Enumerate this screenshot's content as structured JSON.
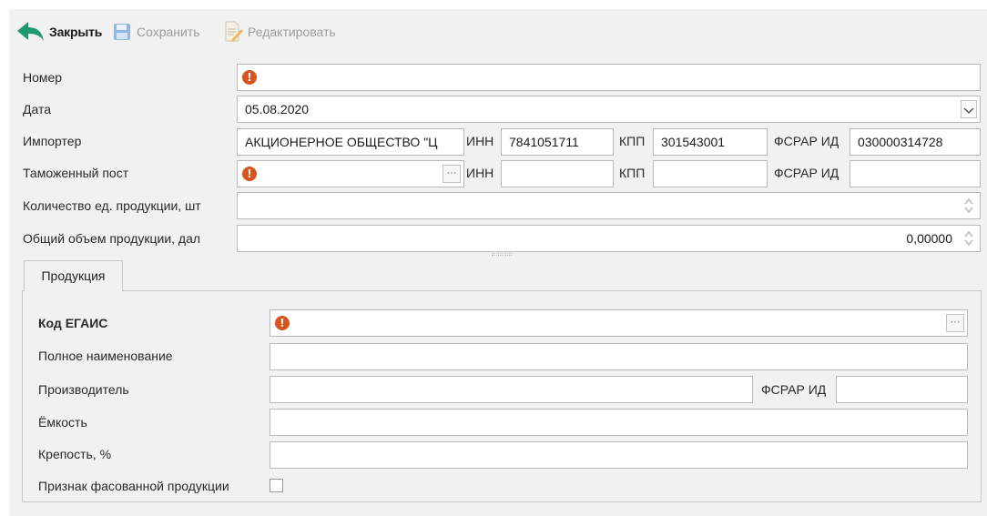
{
  "toolbar": {
    "close_label": "Закрыть",
    "save_label": "Сохранить",
    "edit_label": "Редактировать",
    "close_icon_color": "#1f9a6e",
    "save_icon_color": "#6fa3d8"
  },
  "form": {
    "number": {
      "label": "Номер",
      "value": ""
    },
    "date": {
      "label": "Дата",
      "value": "05.08.2020"
    },
    "importer": {
      "label": "Импортер",
      "name": "АКЦИОНЕРНОЕ ОБЩЕСТВО \"Ц",
      "inn_label": "ИНН",
      "inn": "7841051711",
      "kpp_label": "КПП",
      "kpp": "301543001",
      "fsrar_label": "ФСРАР ИД",
      "fsrar": "030000314728"
    },
    "customs": {
      "label": "Таможенный пост",
      "name": "",
      "inn_label": "ИНН",
      "inn": "",
      "kpp_label": "КПП",
      "kpp": "",
      "fsrar_label": "ФСРАР ИД",
      "fsrar": ""
    },
    "quantity": {
      "label": "Количество ед. продукции, шт",
      "value": ""
    },
    "volume": {
      "label": "Общий объем продукции, дал",
      "value": "0,00000"
    }
  },
  "tabs": [
    {
      "label": "Продукция"
    }
  ],
  "product": {
    "egais": {
      "label": "Код ЕГАИС",
      "value": ""
    },
    "full_name": {
      "label": "Полное наименование",
      "value": ""
    },
    "producer": {
      "label": "Производитель",
      "value": "",
      "fsrar_label": "ФСРАР ИД",
      "fsrar": ""
    },
    "capacity": {
      "label": "Ёмкость",
      "value": ""
    },
    "strength": {
      "label": "Крепость, %",
      "value": ""
    },
    "packaged": {
      "label": "Признак фасованной продукции",
      "checked": false
    }
  },
  "icons": {
    "error": "error-icon",
    "dots": "ellipsis-icon",
    "dropdown": "chevron-down-icon",
    "spinner": "spinner-arrows-icon"
  }
}
